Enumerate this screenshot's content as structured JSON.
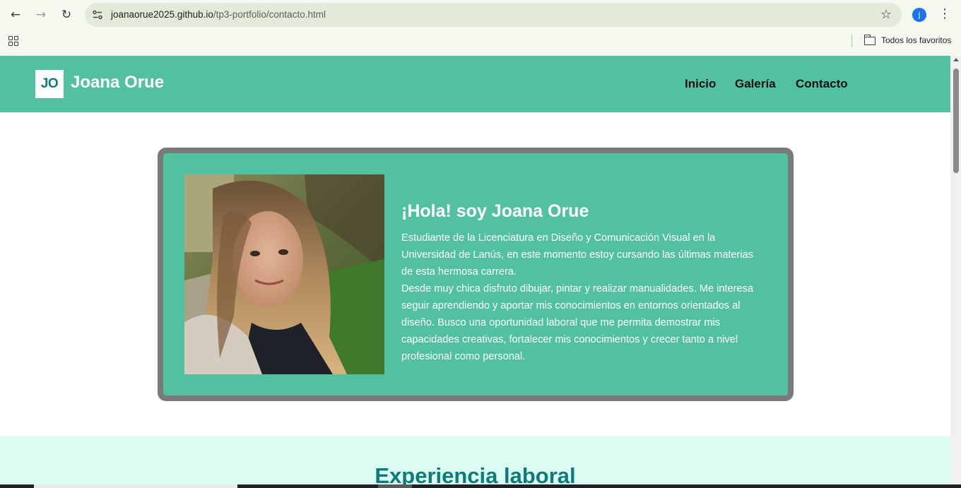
{
  "browser": {
    "back_icon": "back-arrow-icon",
    "forward_icon": "forward-arrow-icon",
    "reload_icon": "reload-icon",
    "url_host": "joanaorue2025.github.io",
    "url_path": "/tp3-portfolio/contacto.html",
    "profile_initial": "j",
    "bookmarks_folder": "Todos los favoritos"
  },
  "header": {
    "logo": "JO",
    "brand": "Joana Orue",
    "nav": [
      "Inicio",
      "Galería",
      "Contacto"
    ]
  },
  "intro": {
    "title": "¡Hola! soy Joana Orue",
    "paragraph1": "Estudiante de la Licenciatura en Diseño y Comunicación Visual en la Universidad de Lanús, en este momento estoy cursando las últimas materias de esta hermosa carrera.",
    "paragraph2": "Desde muy chica disfruto dibujar, pintar y realizar manualidades. Me interesa seguir aprendiendo y aportar mis conocimientos en entornos orientados al diseño. Busco una oportunidad laboral que me permita demostrar mis capacidades creativas, fortalecer mis conocimientos y crecer tanto a nivel profesional como personal."
  },
  "experience": {
    "title": "Experiencia laboral"
  },
  "colors": {
    "header_bg": "#52c19f",
    "card_border": "#7a7a7a",
    "accent_teal": "#0e7b78",
    "section_bg": "#dafcf2"
  }
}
